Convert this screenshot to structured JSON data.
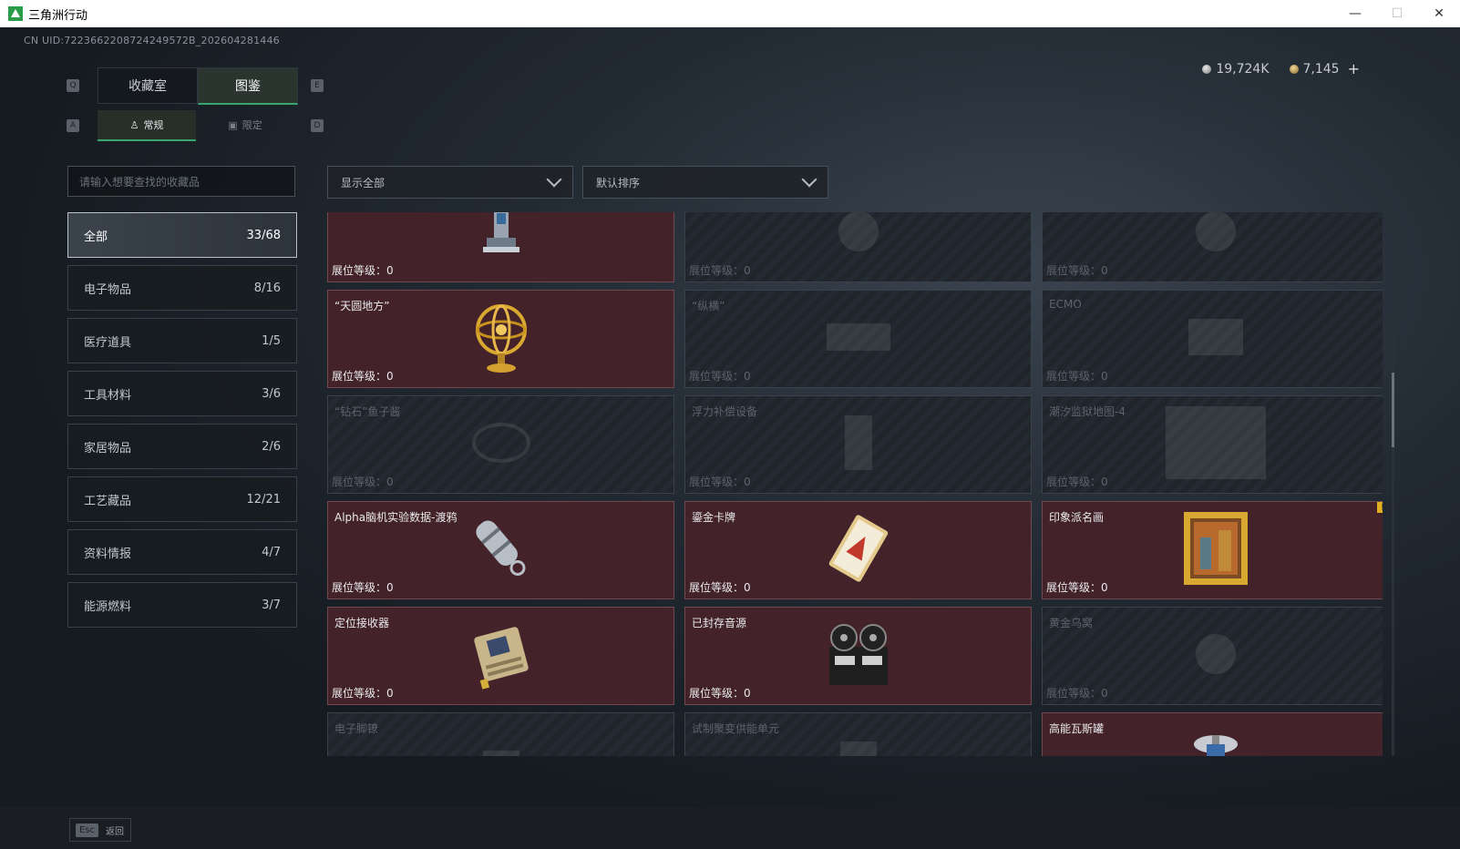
{
  "window": {
    "title": "三角洲行动",
    "minimize": "—",
    "maximize": "☐",
    "close": "✕"
  },
  "uid": "CN UID:7223662208724249572B_202604281446",
  "currency": {
    "silver": "19,724K",
    "gold": "7,145",
    "plus": "+"
  },
  "keys": {
    "q": "Q",
    "e": "E",
    "a": "A",
    "d": "D"
  },
  "tabs": [
    "收藏室",
    "图鉴"
  ],
  "subtabs": [
    "常规",
    "限定"
  ],
  "search": {
    "placeholder": "请输入想要查找的收藏品"
  },
  "filter": {
    "label": "显示全部"
  },
  "sort": {
    "label": "默认排序"
  },
  "categories": [
    {
      "label": "全部",
      "count": "33/68"
    },
    {
      "label": "电子物品",
      "count": "8/16"
    },
    {
      "label": "医疗道具",
      "count": "1/5"
    },
    {
      "label": "工具材料",
      "count": "3/6"
    },
    {
      "label": "家居物品",
      "count": "2/6"
    },
    {
      "label": "工艺藏品",
      "count": "12/21"
    },
    {
      "label": "资料情报",
      "count": "4/7"
    },
    {
      "label": "能源燃料",
      "count": "3/7"
    }
  ],
  "level_label": "展位等级：",
  "cards": [
    {
      "name": "",
      "level": "0",
      "owned": true,
      "icon": "robot-arm-icon"
    },
    {
      "name": "",
      "level": "0",
      "owned": false,
      "icon": "unknown-item-icon"
    },
    {
      "name": "",
      "level": "0",
      "owned": false,
      "icon": "unknown-item-icon"
    },
    {
      "name": "“天圆地方”",
      "level": "0",
      "owned": true,
      "icon": "armillary-sphere-icon"
    },
    {
      "name": "“纵横”",
      "level": "0",
      "owned": false,
      "icon": "chessboard-icon"
    },
    {
      "name": "ECMO",
      "level": "0",
      "owned": false,
      "icon": "ecmo-icon"
    },
    {
      "name": "“钻石”鱼子酱",
      "level": "0",
      "owned": false,
      "icon": "caviar-tin-icon"
    },
    {
      "name": "浮力补偿设备",
      "level": "0",
      "owned": false,
      "icon": "bcd-icon"
    },
    {
      "name": "潮汐监狱地图-4",
      "level": "0",
      "owned": false,
      "icon": "map-icon"
    },
    {
      "name": "Alpha脑机实验数据-渡鸦",
      "level": "0",
      "owned": true,
      "icon": "data-capsule-icon"
    },
    {
      "name": "鎏金卡牌",
      "level": "0",
      "owned": true,
      "icon": "golden-card-icon"
    },
    {
      "name": "印象派名画",
      "level": "0",
      "owned": true,
      "icon": "framed-painting-icon",
      "warn": "!"
    },
    {
      "name": "定位接收器",
      "level": "0",
      "owned": true,
      "icon": "locator-receiver-icon"
    },
    {
      "name": "已封存音源",
      "level": "0",
      "owned": true,
      "icon": "reel-recorder-icon"
    },
    {
      "name": "黄金乌窝",
      "level": "0",
      "owned": false,
      "icon": "nest-icon"
    },
    {
      "name": "电子脚镣",
      "level": "",
      "owned": false,
      "icon": "ankle-monitor-icon"
    },
    {
      "name": "试制聚变供能单元",
      "level": "",
      "owned": false,
      "icon": "fusion-unit-icon"
    },
    {
      "name": "高能瓦斯罐",
      "level": "",
      "owned": true,
      "icon": "gas-canister-icon"
    }
  ],
  "bottom": {
    "esc_key": "Esc",
    "back_label": "返回"
  }
}
